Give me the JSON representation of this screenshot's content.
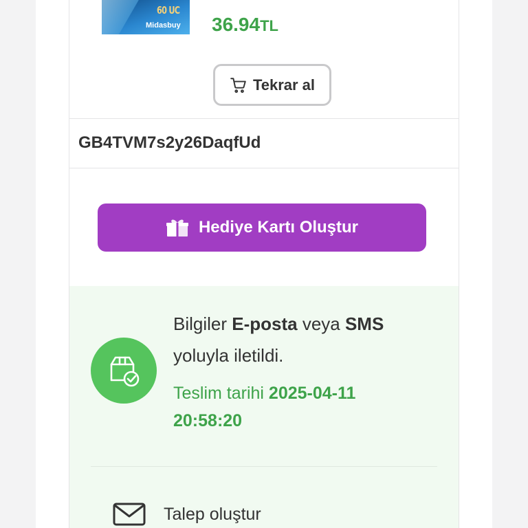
{
  "product": {
    "image_uc": "60 UC",
    "image_brand": "Midasbuy",
    "price_value": "36.94",
    "price_currency": "TL"
  },
  "reorder": {
    "label": "Tekrar al",
    "icon": "cart-icon"
  },
  "code": "GB4TVM7s2y26DaqfUd",
  "gift_button": {
    "label": "Hediye Kartı Oluştur",
    "icon": "gift-icon",
    "color": "#a13dc3"
  },
  "info": {
    "text_1": "Bilgiler ",
    "email": "E-posta",
    "text_2": " veya ",
    "sms": "SMS",
    "text_3": " yoluyla iletildi.",
    "icon": "package-check-icon"
  },
  "delivery": {
    "label": "Teslim tarihi ",
    "date": "2025-04-11",
    "time": "20:58:20",
    "color": "#3ea34a"
  },
  "request": {
    "label": "Talep oluştur",
    "icon": "mail-icon"
  }
}
